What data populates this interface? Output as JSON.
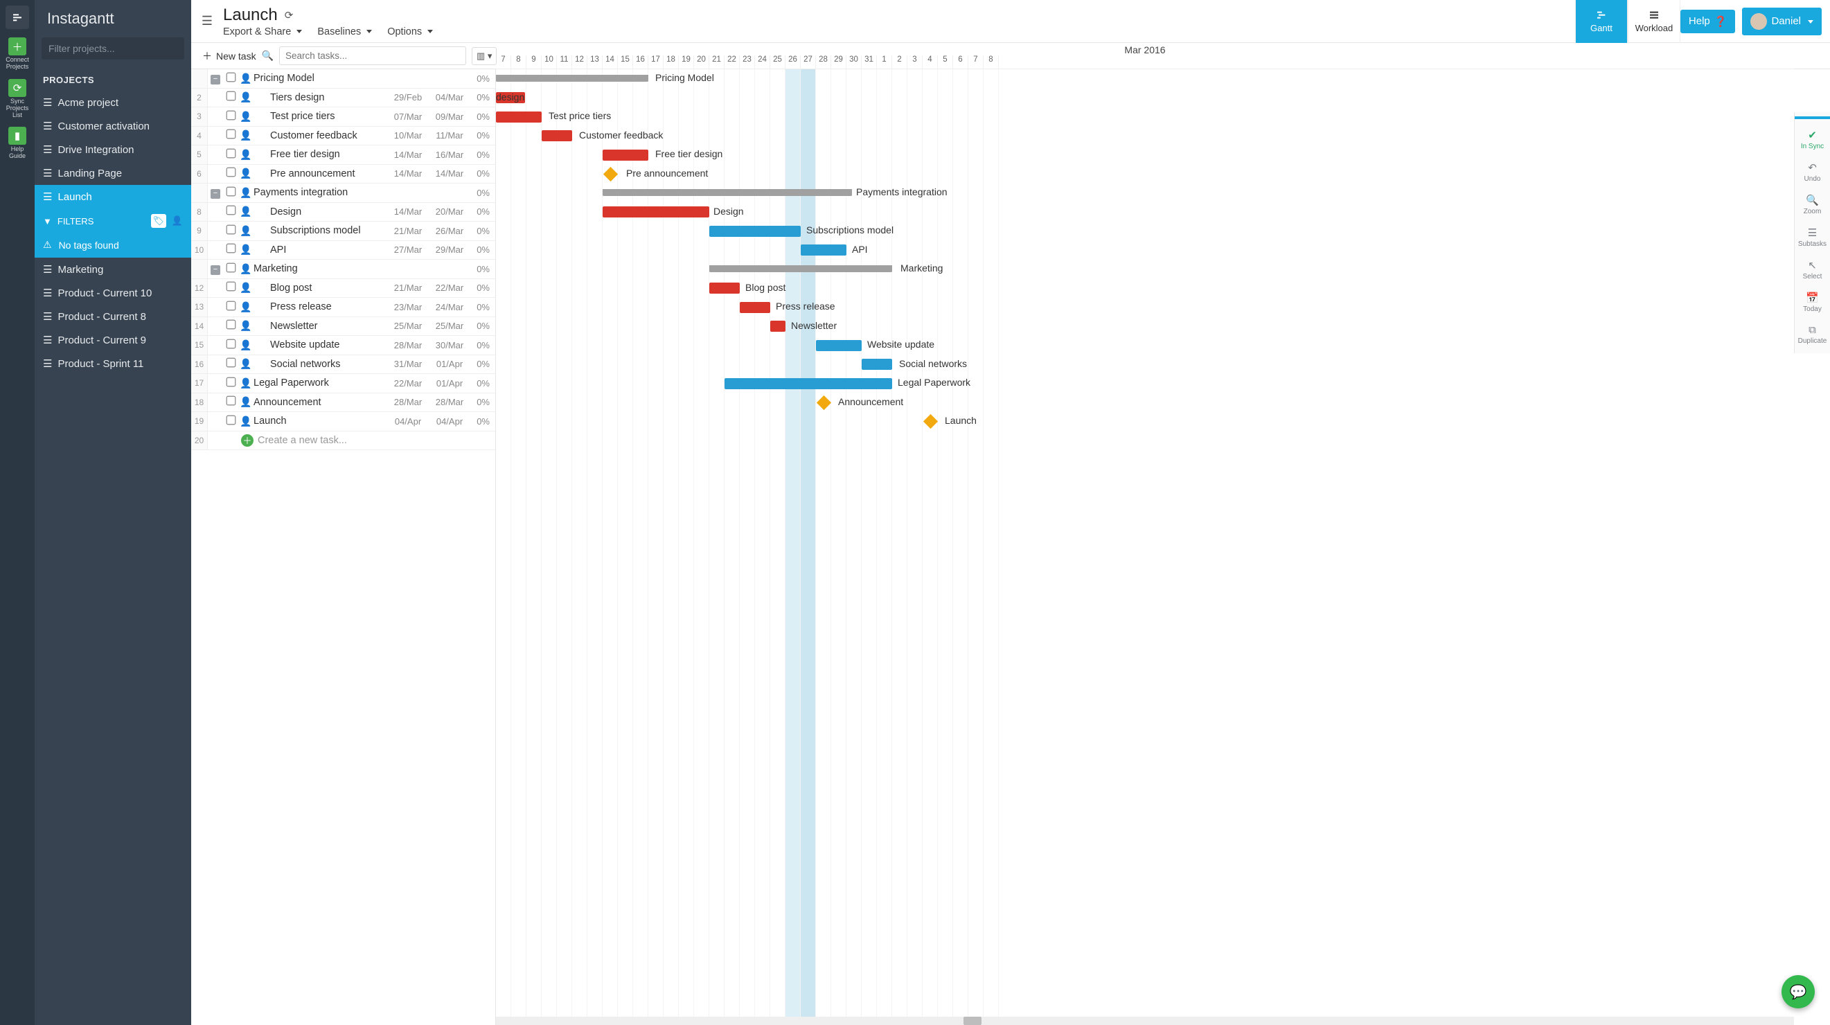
{
  "brand": "Instagantt",
  "iconbar": {
    "connect": "Connect\nProjects",
    "sync": "Sync\nProjects\nList",
    "guide": "Help\nGuide"
  },
  "sidebar": {
    "filter_placeholder": "Filter projects...",
    "section": "PROJECTS",
    "projects": [
      {
        "name": "Acme project"
      },
      {
        "name": "Customer activation"
      },
      {
        "name": "Drive Integration"
      },
      {
        "name": "Landing Page"
      },
      {
        "name": "Launch",
        "active": true
      },
      {
        "name": "Marketing"
      },
      {
        "name": "Product - Current 10"
      },
      {
        "name": "Product - Current 8"
      },
      {
        "name": "Product - Current 9"
      },
      {
        "name": "Product - Sprint 11"
      }
    ],
    "filters_label": "FILTERS",
    "notags": "No tags found"
  },
  "header": {
    "title": "Launch",
    "menu": {
      "export": "Export & Share",
      "baselines": "Baselines",
      "options": "Options"
    },
    "modes": {
      "gantt": "Gantt",
      "workload": "Workload"
    },
    "help": "Help",
    "user": "Daniel"
  },
  "toolbar": {
    "newtask": "New task",
    "search_placeholder": "Search tasks..."
  },
  "timeline": {
    "month": "Mar 2016",
    "days": [
      "7",
      "8",
      "9",
      "10",
      "11",
      "12",
      "13",
      "14",
      "15",
      "16",
      "17",
      "18",
      "19",
      "20",
      "21",
      "22",
      "23",
      "24",
      "25",
      "26",
      "27",
      "28",
      "29",
      "30",
      "31",
      "1",
      "2",
      "3",
      "4",
      "5",
      "6",
      "7",
      "8"
    ]
  },
  "rtoolbar": {
    "sync": "In Sync",
    "undo": "Undo",
    "zoom": "Zoom",
    "subtasks": "Subtasks",
    "select": "Select",
    "today": "Today",
    "duplicate": "Duplicate"
  },
  "tasks": [
    {
      "num": "",
      "group": true,
      "name": "Pricing Model",
      "d1": "",
      "d2": "",
      "pct": "0%",
      "bar": {
        "type": "gray",
        "start": 0,
        "len": 220,
        "label": "Pricing Model",
        "labelOffset": 230
      }
    },
    {
      "num": "2",
      "name": "Tiers design",
      "d1": "29/Feb",
      "d2": "04/Mar",
      "pct": "0%",
      "bar": {
        "type": "red",
        "start": 0,
        "len": 42,
        "label": "design",
        "labelLeft": true
      }
    },
    {
      "num": "3",
      "name": "Test price tiers",
      "d1": "07/Mar",
      "d2": "09/Mar",
      "pct": "0%",
      "bar": {
        "type": "red",
        "start": 0,
        "len": 66,
        "label": "Test price tiers",
        "labelOffset": 76
      }
    },
    {
      "num": "4",
      "name": "Customer feedback",
      "d1": "10/Mar",
      "d2": "11/Mar",
      "pct": "0%",
      "bar": {
        "type": "red",
        "start": 66,
        "len": 44,
        "label": "Customer feedback",
        "labelOffset": 120
      }
    },
    {
      "num": "5",
      "name": "Free tier design",
      "d1": "14/Mar",
      "d2": "16/Mar",
      "pct": "0%",
      "bar": {
        "type": "red",
        "start": 154,
        "len": 66,
        "label": "Free tier design",
        "labelOffset": 230
      }
    },
    {
      "num": "6",
      "name": "Pre announcement",
      "d1": "14/Mar",
      "d2": "14/Mar",
      "pct": "0%",
      "bar": {
        "type": "diamond",
        "start": 158,
        "label": "Pre announcement",
        "labelOffset": 188
      }
    },
    {
      "num": "",
      "group": true,
      "name": "Payments integration",
      "d1": "",
      "d2": "",
      "pct": "0%",
      "bar": {
        "type": "gray",
        "start": 154,
        "len": 360,
        "label": "Payments integration",
        "labelOffset": 520
      }
    },
    {
      "num": "8",
      "name": "Design",
      "d1": "14/Mar",
      "d2": "20/Mar",
      "pct": "0%",
      "bar": {
        "type": "red",
        "start": 154,
        "len": 154,
        "label": "Design",
        "labelOffset": 314
      }
    },
    {
      "num": "9",
      "name": "Subscriptions model",
      "d1": "21/Mar",
      "d2": "26/Mar",
      "pct": "0%",
      "bar": {
        "type": "blue",
        "start": 308,
        "len": 132,
        "label": "Subscriptions model",
        "labelOffset": 448
      }
    },
    {
      "num": "10",
      "name": "API",
      "d1": "27/Mar",
      "d2": "29/Mar",
      "pct": "0%",
      "bar": {
        "type": "blue",
        "start": 440,
        "len": 66,
        "label": "API",
        "labelOffset": 514
      }
    },
    {
      "num": "",
      "group": true,
      "name": "Marketing",
      "d1": "",
      "d2": "",
      "pct": "0%",
      "bar": {
        "type": "gray",
        "start": 308,
        "len": 264,
        "label": "Marketing",
        "labelOffset": 584
      }
    },
    {
      "num": "12",
      "name": "Blog post",
      "d1": "21/Mar",
      "d2": "22/Mar",
      "pct": "0%",
      "bar": {
        "type": "red",
        "start": 308,
        "len": 44,
        "label": "Blog post",
        "labelOffset": 360
      }
    },
    {
      "num": "13",
      "name": "Press release",
      "d1": "23/Mar",
      "d2": "24/Mar",
      "pct": "0%",
      "bar": {
        "type": "red",
        "start": 352,
        "len": 44,
        "label": "Press release",
        "labelOffset": 404
      }
    },
    {
      "num": "14",
      "name": "Newsletter",
      "d1": "25/Mar",
      "d2": "25/Mar",
      "pct": "0%",
      "bar": {
        "type": "red",
        "start": 396,
        "len": 22,
        "label": "Newsletter",
        "labelOffset": 426
      }
    },
    {
      "num": "15",
      "name": "Website update",
      "d1": "28/Mar",
      "d2": "30/Mar",
      "pct": "0%",
      "bar": {
        "type": "blue",
        "start": 462,
        "len": 66,
        "label": "Website update",
        "labelOffset": 536
      }
    },
    {
      "num": "16",
      "name": "Social networks",
      "d1": "31/Mar",
      "d2": "01/Apr",
      "pct": "0%",
      "bar": {
        "type": "blue",
        "start": 528,
        "len": 44,
        "label": "Social networks",
        "labelOffset": 582
      }
    },
    {
      "num": "17",
      "group": false,
      "top": true,
      "name": "Legal Paperwork",
      "d1": "22/Mar",
      "d2": "01/Apr",
      "pct": "0%",
      "bar": {
        "type": "blue",
        "start": 330,
        "len": 242,
        "label": "Legal Paperwork",
        "labelOffset": 580
      }
    },
    {
      "num": "18",
      "top": true,
      "name": "Announcement",
      "d1": "28/Mar",
      "d2": "28/Mar",
      "pct": "0%",
      "bar": {
        "type": "diamond",
        "start": 466,
        "label": "Announcement",
        "labelOffset": 494
      }
    },
    {
      "num": "19",
      "top": true,
      "name": "Launch",
      "d1": "04/Apr",
      "d2": "04/Apr",
      "pct": "0%",
      "bar": {
        "type": "diamond",
        "start": 620,
        "label": "Launch",
        "labelOffset": 648
      }
    }
  ],
  "newtask_placeholder": "Create a new task...",
  "last_num": "20"
}
